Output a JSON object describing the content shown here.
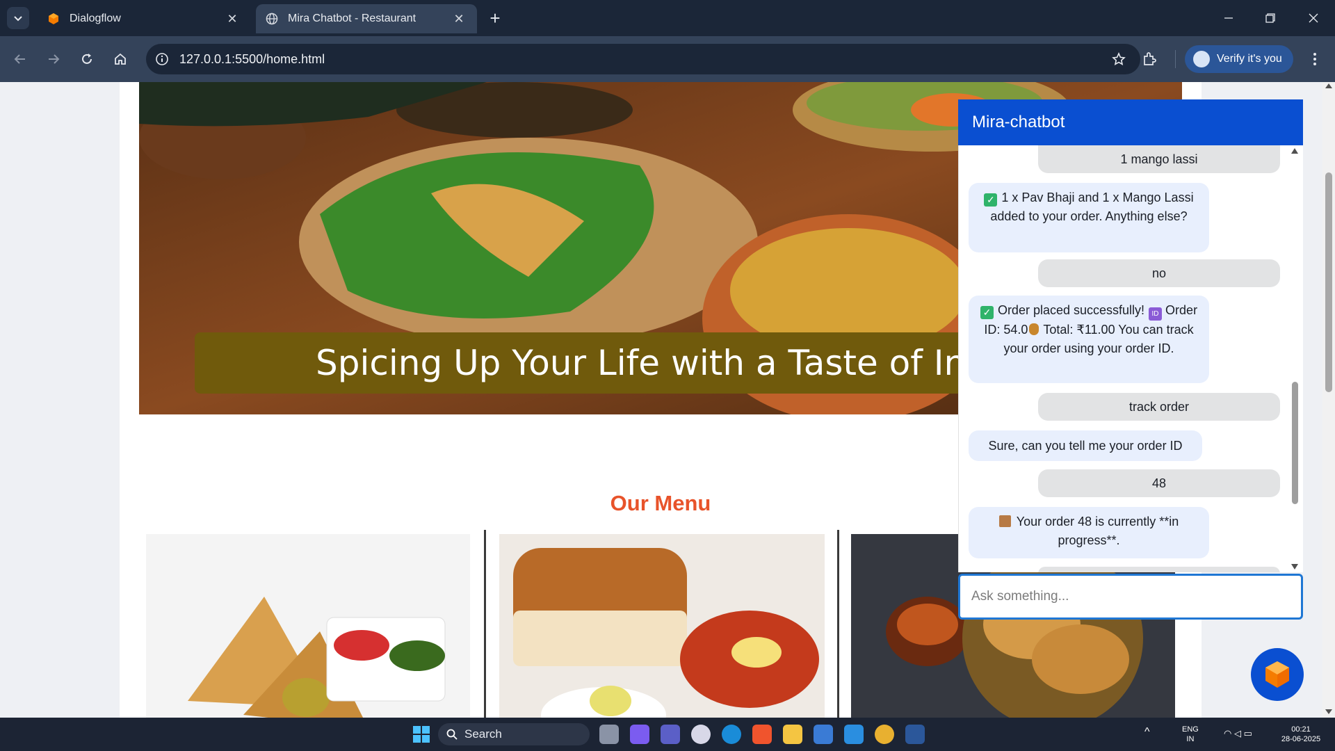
{
  "browser": {
    "tabs": [
      {
        "title": "Dialogflow",
        "active": false
      },
      {
        "title": "Mira Chatbot - Restaurant",
        "active": true
      }
    ],
    "url": "127.0.0.1:5500/home.html",
    "profile_button": "Verify it's you"
  },
  "page": {
    "hero_banner_text": "Spicing Up Your Life with a Taste of India",
    "menu_title": "Our Menu"
  },
  "chatbot": {
    "title": "Mira-chatbot",
    "messages": [
      {
        "from": "user",
        "text": "1 mango lassi"
      },
      {
        "from": "bot",
        "text": "1 x Pav Bhaji and 1 x Mango Lassi added to your order. Anything else?"
      },
      {
        "from": "user",
        "text": "no"
      },
      {
        "from": "bot",
        "part1": "Order placed successfully!",
        "part2": "Order ID: 54.0",
        "part3": "Total: ₹11.00 You can track your order using your order ID."
      },
      {
        "from": "user",
        "text": "track order"
      },
      {
        "from": "bot",
        "text": "Sure, can you tell me your order ID"
      },
      {
        "from": "user",
        "text": "48"
      },
      {
        "from": "bot",
        "text": "Your order 48 is currently **in progress**."
      }
    ],
    "input_placeholder": "Ask something..."
  },
  "taskbar": {
    "search_label": "Search",
    "lang": "ENG",
    "region": "IN",
    "time": "00:21",
    "date": "28-06-2025"
  },
  "colors": {
    "chat_header": "#0a4fd1",
    "menu_title": "#e8532a",
    "banner": "#705a0c"
  }
}
